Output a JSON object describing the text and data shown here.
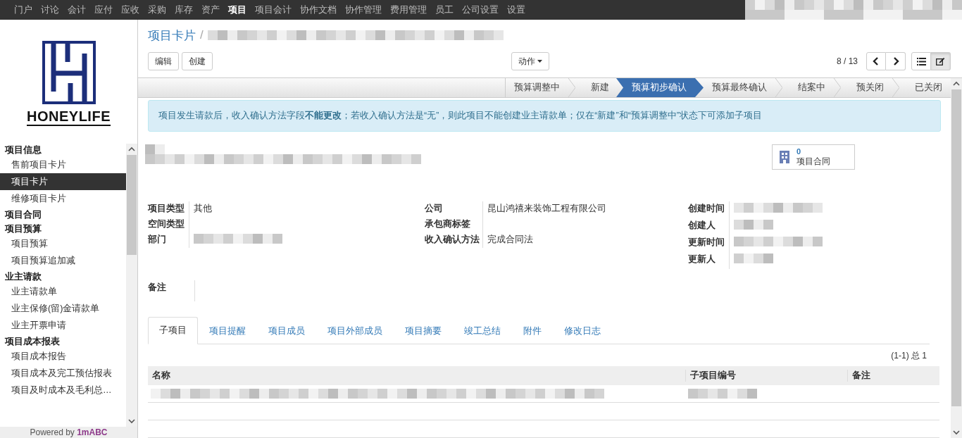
{
  "top_menu": [
    {
      "label": "门户",
      "selected": false
    },
    {
      "label": "讨论",
      "selected": false
    },
    {
      "label": "会计",
      "selected": false
    },
    {
      "label": "应付",
      "selected": false
    },
    {
      "label": "应收",
      "selected": false
    },
    {
      "label": "采购",
      "selected": false
    },
    {
      "label": "库存",
      "selected": false
    },
    {
      "label": "资产",
      "selected": false
    },
    {
      "label": "项目",
      "selected": true
    },
    {
      "label": "项目会计",
      "selected": false
    },
    {
      "label": "协作文档",
      "selected": false
    },
    {
      "label": "协作管理",
      "selected": false
    },
    {
      "label": "费用管理",
      "selected": false
    },
    {
      "label": "员工",
      "selected": false
    },
    {
      "label": "公司设置",
      "selected": false
    },
    {
      "label": "设置",
      "selected": false
    }
  ],
  "logo": {
    "text": "HONEYLIFE"
  },
  "sidebar": {
    "sections": [
      {
        "title": "项目信息",
        "items": [
          {
            "label": "售前项目卡片",
            "selected": false
          },
          {
            "label": "项目卡片",
            "selected": true
          },
          {
            "label": "维修项目卡片",
            "selected": false
          }
        ]
      },
      {
        "title": "项目合同"
      },
      {
        "title": "项目预算",
        "items": [
          {
            "label": "项目预算",
            "selected": false
          },
          {
            "label": "项目预算追加减",
            "selected": false
          }
        ]
      },
      {
        "title": "业主请款",
        "items": [
          {
            "label": "业主请款单",
            "selected": false
          },
          {
            "label": "业主保修(留)金请款单",
            "selected": false
          },
          {
            "label": "业主开票申请",
            "selected": false
          }
        ]
      },
      {
        "title": "项目成本报表",
        "items": [
          {
            "label": "项目成本报告",
            "selected": false
          },
          {
            "label": "项目成本及完工预估报表",
            "selected": false
          },
          {
            "label": "项目及时成本及毛利总…",
            "selected": false
          }
        ]
      }
    ]
  },
  "footer": {
    "prefix": "Powered by",
    "brand": "1mABC"
  },
  "breadcrumb": {
    "parent": "项目卡片",
    "separator": "/"
  },
  "buttons": [
    "编辑",
    "创建"
  ],
  "action_menu": "动作",
  "pager": "8 / 13",
  "views": [
    {
      "kind": "list",
      "selected": false
    },
    {
      "kind": "form",
      "selected": true
    }
  ],
  "stages": [
    {
      "label": "预算调整中",
      "selected": false
    },
    {
      "label": "新建",
      "selected": false
    },
    {
      "label": "预算初步确认",
      "selected": true
    },
    {
      "label": "预算最终确认",
      "selected": false
    },
    {
      "label": "结案中",
      "selected": false
    },
    {
      "label": "预关闭",
      "selected": false
    },
    {
      "label": "已关闭",
      "selected": false
    }
  ],
  "notice": "项目发生请款后，收入确认方法字段**不能更改**；若收入确认方法是“无”，则此项目不能创建业主请款单；仅在“新建”和“预算调整中”状态下可添加子项目",
  "smart_button": {
    "count": "0",
    "label": "项目合同"
  },
  "field_columns": [
    [
      {
        "label": "项目类型",
        "kind": "text",
        "value": "其他"
      },
      {
        "label": "空间类型",
        "kind": "empty"
      },
      {
        "label": "部门",
        "kind": "redacted"
      }
    ],
    [
      {
        "label": "公司",
        "kind": "text",
        "value": "昆山鸿禧来装饰工程有限公司"
      },
      {
        "label": "承包商标签",
        "kind": "empty"
      },
      {
        "label": "收入确认方法",
        "kind": "text",
        "value": "完成合同法"
      }
    ],
    [
      {
        "label": "创建时间",
        "kind": "redacted"
      },
      {
        "label": "创建人",
        "kind": "redacted"
      },
      {
        "label": "更新时间",
        "kind": "redacted"
      },
      {
        "label": "更新人",
        "kind": "redacted"
      }
    ]
  ],
  "note_label": "备注",
  "tabs": [
    {
      "label": "子项目",
      "selected": true
    },
    {
      "label": "项目提醒",
      "selected": false
    },
    {
      "label": "项目成员",
      "selected": false
    },
    {
      "label": "项目外部成员",
      "selected": false
    },
    {
      "label": "项目摘要",
      "selected": false
    },
    {
      "label": "竣工总结",
      "selected": false
    },
    {
      "label": "附件",
      "selected": false
    },
    {
      "label": "修改日志",
      "selected": false
    }
  ],
  "table": {
    "pager": "(1-1) 总 1",
    "columns": [
      "名称",
      "子项目编号",
      "备注"
    ],
    "rows": [
      {
        "kind": "redacted"
      }
    ]
  }
}
